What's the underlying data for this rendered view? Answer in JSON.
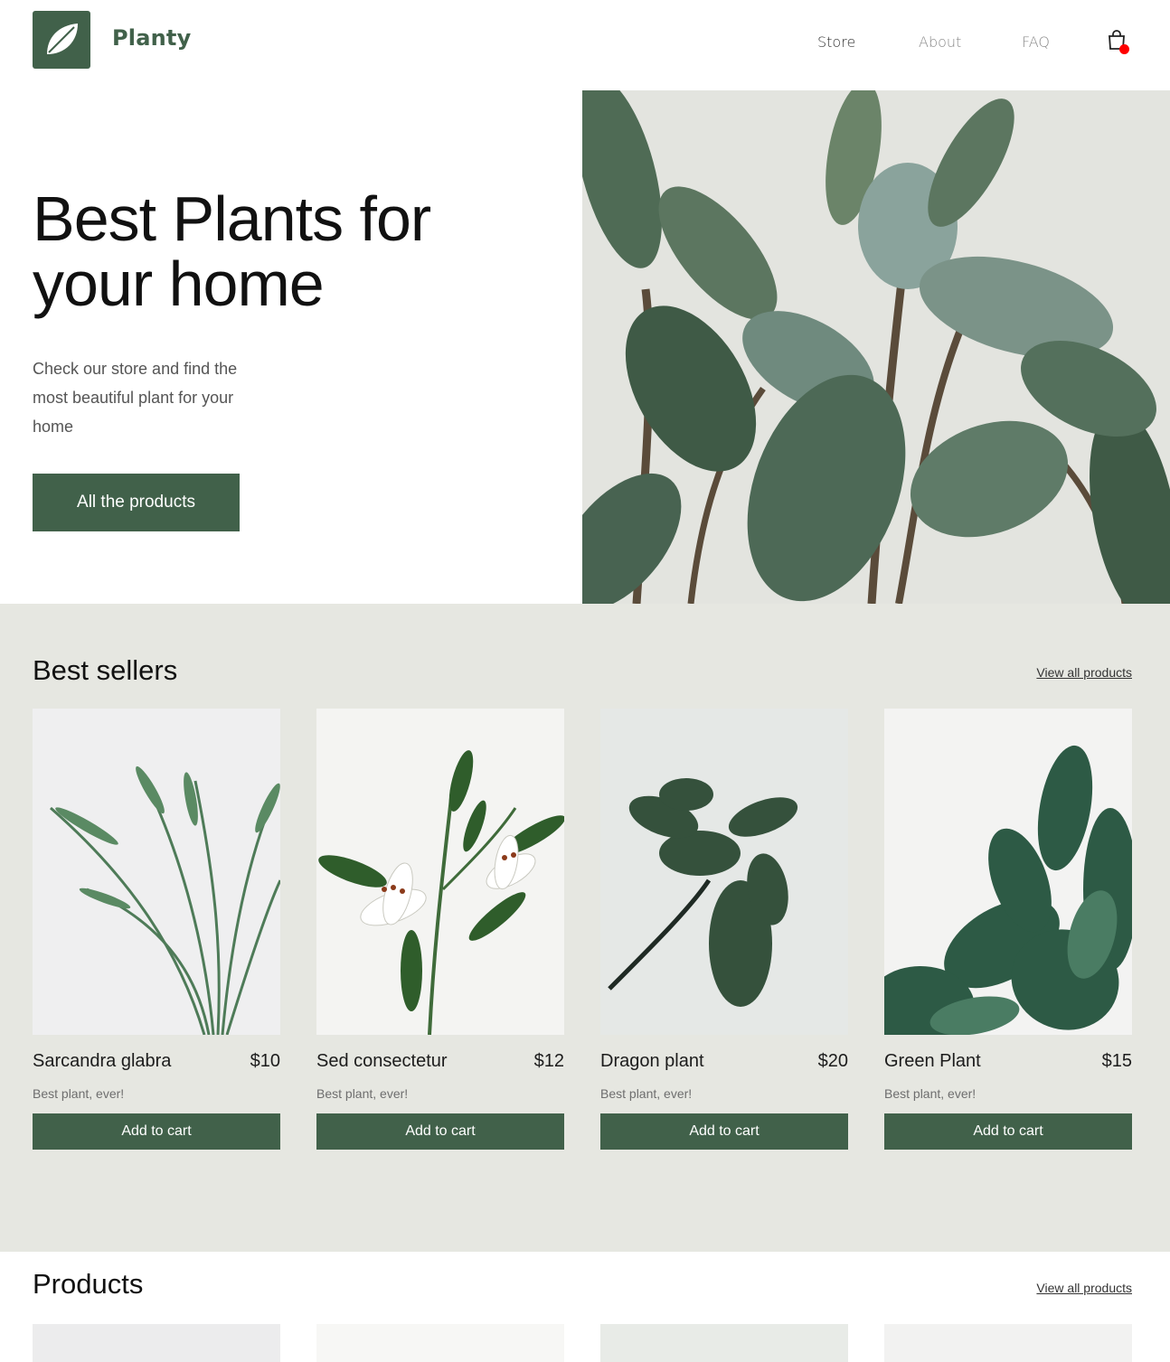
{
  "header": {
    "brand": "Planty",
    "nav": [
      {
        "label": "Store"
      },
      {
        "label": "About"
      },
      {
        "label": "FAQ"
      }
    ]
  },
  "hero": {
    "title_line1": "Best Plants for",
    "title_line2": "your home",
    "subtitle": "Check our store and find the most beautiful plant for your home",
    "cta": "All the products"
  },
  "best_sellers": {
    "title": "Best sellers",
    "view_all": "View all products",
    "products": [
      {
        "name": "Sarcandra glabra",
        "price": "$10",
        "desc": "Best plant, ever!",
        "button": "Add to cart"
      },
      {
        "name": "Sed consectetur",
        "price": "$12",
        "desc": "Best plant, ever!",
        "button": "Add to cart"
      },
      {
        "name": "Dragon plant",
        "price": "$20",
        "desc": "Best plant, ever!",
        "button": "Add to cart"
      },
      {
        "name": "Green Plant",
        "price": "$15",
        "desc": "Best plant, ever!",
        "button": "Add to cart"
      }
    ]
  },
  "products_section": {
    "title": "Products",
    "view_all": "View all products"
  },
  "colors": {
    "brand": "#41614a",
    "section_bg": "#e6e7e1",
    "cart_badge": "#ff0000"
  }
}
